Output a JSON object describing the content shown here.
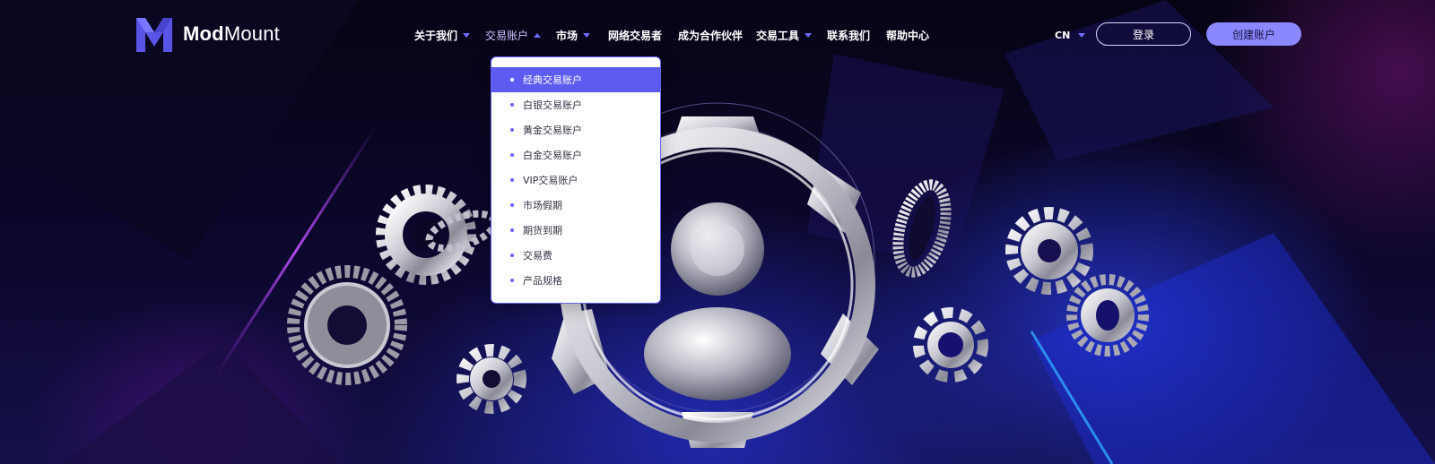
{
  "brand": {
    "name_bold": "Mod",
    "name_regular": "Mount"
  },
  "nav": {
    "items": [
      {
        "label": "关于我们",
        "has_caret": true
      },
      {
        "label": "交易账户",
        "has_caret": true,
        "active": true
      },
      {
        "label": "市场",
        "has_caret": true
      },
      {
        "label": "网络交易者",
        "has_caret": false
      },
      {
        "label": "成为合作伙伴",
        "has_caret": false
      },
      {
        "label": "交易工具",
        "has_caret": true
      },
      {
        "label": "联系我们",
        "has_caret": false
      },
      {
        "label": "帮助中心",
        "has_caret": false
      }
    ]
  },
  "header": {
    "language": "CN",
    "login_label": "登录",
    "signup_label": "创建账户"
  },
  "dropdown": {
    "selected_index": 0,
    "items": [
      "经典交易账户",
      "白银交易账户",
      "黄金交易账户",
      "白金交易账户",
      "VIP交易账户",
      "市场假期",
      "期货到期",
      "交易费",
      "产品规格"
    ]
  },
  "colors": {
    "accent": "#6a64ff",
    "dropdown_selected": "#5d5bf2",
    "signup_button": "#8a87ff",
    "background": "#07041a"
  },
  "icons": {
    "logo": "modmount-logo-icon",
    "caret": "caret-down-icon"
  }
}
